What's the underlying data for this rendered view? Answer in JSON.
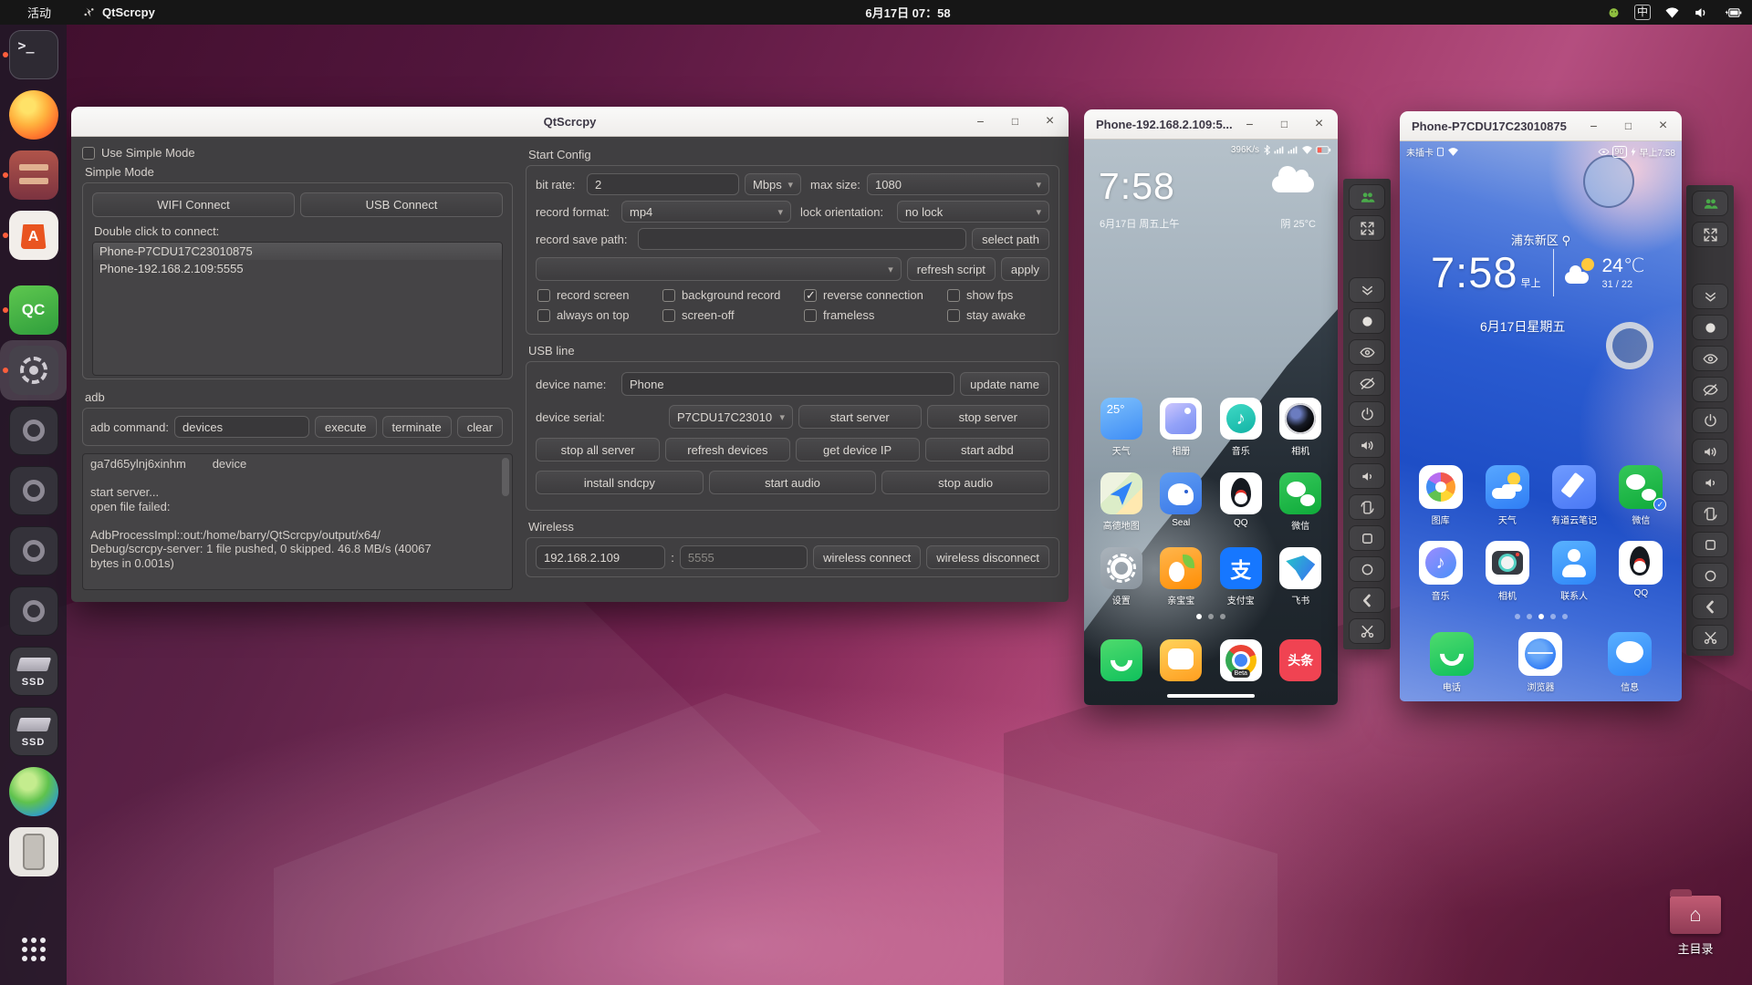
{
  "topbar": {
    "activities": "活动",
    "app_name": "QtScrcpy",
    "clock": "6月17日 07：58",
    "input_method": "中"
  },
  "dock": {
    "items": [
      {
        "id": "terminal",
        "dot": true
      },
      {
        "id": "firefox",
        "dot": false
      },
      {
        "id": "files",
        "dot": true
      },
      {
        "id": "software",
        "dot": true
      },
      {
        "id": "qc",
        "dot": true,
        "gap_before": true
      },
      {
        "id": "settings",
        "dot": true,
        "active": true
      },
      {
        "id": "device1",
        "dot": false
      },
      {
        "id": "device2",
        "dot": false
      },
      {
        "id": "device3",
        "dot": false
      },
      {
        "id": "device4",
        "dot": false
      },
      {
        "id": "ssd1",
        "dot": false
      },
      {
        "id": "ssd2",
        "dot": false
      },
      {
        "id": "globe",
        "dot": false
      },
      {
        "id": "phone",
        "dot": false
      },
      {
        "id": "appsgrid",
        "dot": false,
        "bottom": true
      }
    ]
  },
  "main_window": {
    "title": "QtScrcpy",
    "use_simple_mode": "Use Simple Mode",
    "simple_mode": {
      "label": "Simple Mode",
      "wifi_connect": "WIFI Connect",
      "usb_connect": "USB Connect",
      "hint": "Double click to connect:",
      "devices": [
        "Phone-P7CDU17C23010875",
        "Phone-192.168.2.109:5555"
      ]
    },
    "adb": {
      "label": "adb",
      "command_label": "adb command:",
      "command_value": "devices",
      "execute": "execute",
      "terminate": "terminate",
      "clear": "clear",
      "log_lines": [
        "ga7d65ylnj6xinhm        device",
        "",
        "start server...",
        "open file failed:",
        "",
        "AdbProcessImpl::out:/home/barry/QtScrcpy/output/x64/",
        "Debug/scrcpy-server: 1 file pushed, 0 skipped. 46.8 MB/s (40067",
        "bytes in 0.001s)"
      ]
    },
    "start_config": {
      "label": "Start Config",
      "bit_rate_label": "bit rate:",
      "bit_rate_value": "2",
      "bit_rate_unit": "Mbps",
      "max_size_label": "max size:",
      "max_size_value": "1080",
      "record_format_label": "record format:",
      "record_format_value": "mp4",
      "lock_orientation_label": "lock orientation:",
      "lock_orientation_value": "no lock",
      "record_save_path_label": "record save path:",
      "record_save_path_value": "",
      "select_path": "select path",
      "script_value": "",
      "refresh_script": "refresh script",
      "apply": "apply",
      "checkboxes": [
        {
          "label": "record screen",
          "checked": false
        },
        {
          "label": "background record",
          "checked": false
        },
        {
          "label": "reverse connection",
          "checked": true
        },
        {
          "label": "show fps",
          "checked": false
        },
        {
          "label": "always on top",
          "checked": false
        },
        {
          "label": "screen-off",
          "checked": false
        },
        {
          "label": "frameless",
          "checked": false
        },
        {
          "label": "stay awake",
          "checked": false
        }
      ]
    },
    "usb_line": {
      "label": "USB line",
      "device_name_label": "device name:",
      "device_name_value": "Phone",
      "update_name": "update name",
      "device_serial_label": "device serial:",
      "device_serial_value": "P7CDU17C23010",
      "start_server": "start server",
      "stop_server": "stop server",
      "stop_all_server": "stop all server",
      "refresh_devices": "refresh devices",
      "get_device_ip": "get device IP",
      "start_adbd": "start adbd",
      "install_sndcpy": "install sndcpy",
      "start_audio": "start audio",
      "stop_audio": "stop audio"
    },
    "wireless": {
      "label": "Wireless",
      "ip": "192.168.2.109",
      "separator": ":",
      "port_placeholder": "5555",
      "connect": "wireless connect",
      "disconnect": "wireless disconnect"
    }
  },
  "phone1": {
    "title": "Phone-192.168.2.109:5...",
    "status_right": "396K/s",
    "clock": "7:58",
    "date": "6月17日 周五上午",
    "weather": "阴  25°C",
    "apps": [
      {
        "label": "天气",
        "icon": "weather1",
        "glyph": "25°"
      },
      {
        "label": "相册",
        "icon": "gallery1"
      },
      {
        "label": "音乐",
        "icon": "music1"
      },
      {
        "label": "相机",
        "icon": "camera1"
      },
      {
        "label": "高德地图",
        "icon": "amap"
      },
      {
        "label": "Seal",
        "icon": "seal"
      },
      {
        "label": "QQ",
        "icon": "qq"
      },
      {
        "label": "微信",
        "icon": "wechat"
      },
      {
        "label": "设置",
        "icon": "settings1"
      },
      {
        "label": "亲宝宝",
        "icon": "qinbaobao"
      },
      {
        "label": "支付宝",
        "icon": "alipay",
        "glyph": "支"
      },
      {
        "label": "飞书",
        "icon": "feishu"
      }
    ],
    "dock_apps": [
      {
        "icon": "phonecall",
        "name": "phone-app"
      },
      {
        "icon": "mms",
        "name": "messages-app"
      },
      {
        "icon": "chrome",
        "glyph": "Beta",
        "name": "chrome-app"
      },
      {
        "icon": "toutiao",
        "glyph": "头条",
        "name": "toutiao-app"
      }
    ],
    "page_dots": {
      "count": 3,
      "active": 0
    }
  },
  "phone2": {
    "title": "Phone-P7CDU17C23010875",
    "status_left": "未插卡",
    "battery_badge": "90",
    "status_right": "早上7:58",
    "location": "浦东新区",
    "clock": "7:58",
    "clock_suffix": "早上",
    "temp": "24℃",
    "hi_lo": "31 / 22",
    "date": "6月17日星期五",
    "apps": [
      {
        "label": "图库",
        "icon": "gallery2"
      },
      {
        "label": "天气",
        "icon": "weather2"
      },
      {
        "label": "有道云笔记",
        "icon": "youdao"
      },
      {
        "label": "微信",
        "icon": "wechat",
        "badge": true
      },
      {
        "label": "音乐",
        "icon": "music2"
      },
      {
        "label": "相机",
        "icon": "camera2",
        "glyph": ""
      },
      {
        "label": "联系人",
        "icon": "contacts"
      },
      {
        "label": "QQ",
        "icon": "qq"
      }
    ],
    "dock_apps": [
      {
        "label": "电话",
        "icon": "phonecall",
        "name": "phone-app"
      },
      {
        "label": "浏览器",
        "icon": "browser2",
        "name": "browser-app"
      },
      {
        "label": "信息",
        "icon": "messages2",
        "name": "messages-app"
      }
    ],
    "page_dots": {
      "count": 5,
      "active": 2
    }
  },
  "phone_toolbar": {
    "buttons": [
      "group",
      "fullscreen",
      "expand",
      "touch",
      "screen-on",
      "screen-off",
      "power",
      "volume-up",
      "volume-down",
      "flip",
      "app-switch",
      "home",
      "back",
      "screenshot"
    ]
  },
  "desktop": {
    "home_label": "主目录"
  },
  "colors": {
    "accent_orange": "#e95420",
    "toolbar_green": "#4cae4c",
    "selection_bg": "#4e4d4f"
  }
}
